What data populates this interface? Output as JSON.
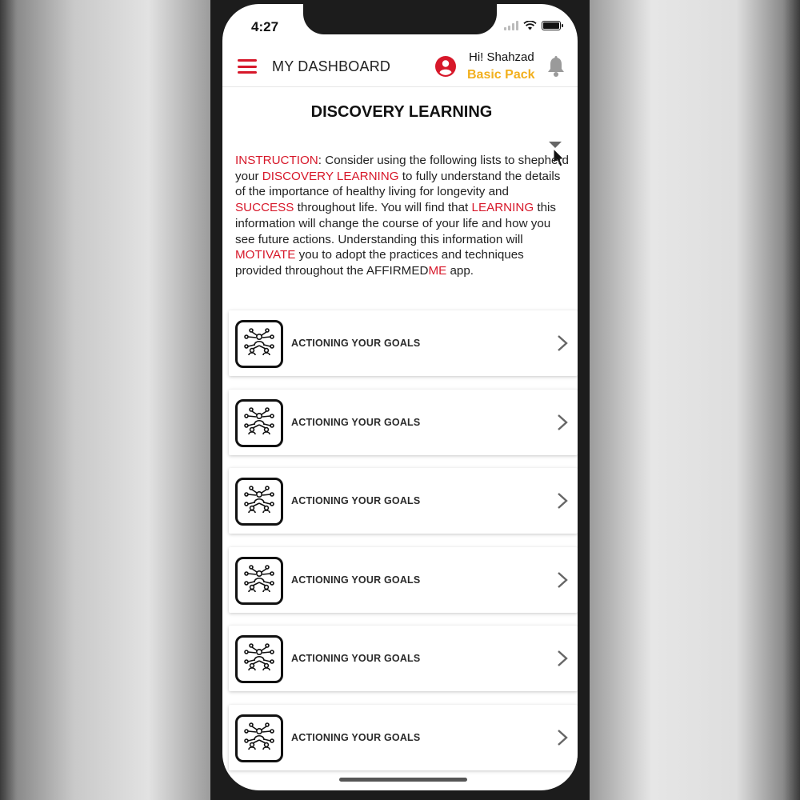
{
  "status_bar": {
    "time": "4:27"
  },
  "header": {
    "title": "MY DASHBOARD",
    "greeting": "Hi! Shahzad",
    "pack": "Basic Pack"
  },
  "page": {
    "title": "DISCOVERY LEARNING",
    "instruction": {
      "s1": "INSTRUCTION",
      "s2": ": Consider using the following lists to shepherd your ",
      "s3": "DISCOVERY LEARNING",
      "s4": " to fully understand the details of the importance of healthy living for longevity and ",
      "s5": "SUCCESS",
      "s6": " throughout life. You will find that ",
      "s7": "LEARNING",
      "s8": " this information will change the course of your life and how you see future actions. Understanding this information will ",
      "s9": "MOTIVATE",
      "s10": " you to adopt the practices and techniques provided throughout the AFFIRMED",
      "s11": "ME",
      "s12": " app."
    }
  },
  "list": {
    "items": [
      {
        "label": "ACTIONING YOUR GOALS"
      },
      {
        "label": "ACTIONING YOUR GOALS"
      },
      {
        "label": "ACTIONING YOUR GOALS"
      },
      {
        "label": "ACTIONING YOUR GOALS"
      },
      {
        "label": "ACTIONING YOUR GOALS"
      },
      {
        "label": "ACTIONING YOUR GOALS"
      }
    ]
  },
  "colors": {
    "accent": "#d7182a",
    "pack": "#f2b01e",
    "text": "#222222"
  },
  "icons": {
    "menu": "hamburger-icon",
    "user": "user-circle-icon",
    "bell": "bell-icon",
    "item": "network-people-icon",
    "chevron": "chevron-right-icon"
  }
}
